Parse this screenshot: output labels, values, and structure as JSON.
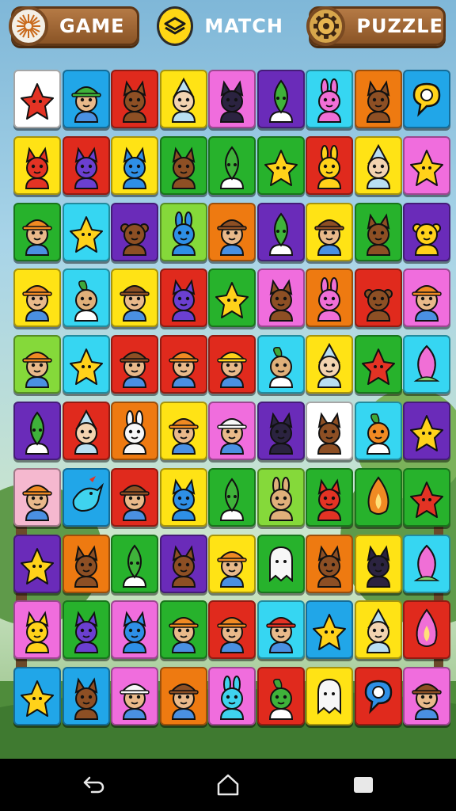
{
  "top_buttons": {
    "game_label": "GAME",
    "match_label": "MATCH",
    "puzzle_label": "PUZZLE"
  },
  "colors": {
    "white": "#ffffff",
    "blue": "#21a6e8",
    "red": "#e02a1d",
    "yellow": "#ffe315",
    "pink": "#f06ddd",
    "purple": "#6a2bb9",
    "cyan": "#36d6f2",
    "orange": "#ee7a11",
    "green": "#27b22c",
    "lime": "#85d93a",
    "lightpink": "#f5b8cf"
  },
  "board": {
    "rows": [
      [
        [
          "white",
          "red",
          "star-creature"
        ],
        [
          "blue",
          "green",
          "elf"
        ],
        [
          "red",
          "brown",
          "fox"
        ],
        [
          "yellow",
          "lightblue",
          "gnome"
        ],
        [
          "pink",
          "dark",
          "cat"
        ],
        [
          "purple",
          "green",
          "leaf-sprite"
        ],
        [
          "cyan",
          "pink",
          "bunny"
        ],
        [
          "orange",
          "brown",
          "fox"
        ],
        [
          "blue",
          "yellow",
          "speech-bubble"
        ]
      ],
      [
        [
          "yellow",
          "red",
          "cat"
        ],
        [
          "red",
          "purple",
          "cat"
        ],
        [
          "yellow",
          "blue",
          "cat"
        ],
        [
          "green",
          "brown",
          "fox"
        ],
        [
          "green",
          "green",
          "leaf-sprite"
        ],
        [
          "green",
          "yellow",
          "star-creature"
        ],
        [
          "red",
          "yellow",
          "bunny"
        ],
        [
          "yellow",
          "lightblue",
          "gnome"
        ],
        [
          "pink",
          "yellow",
          "star-creature"
        ]
      ],
      [
        [
          "green",
          "orange",
          "hat-kid"
        ],
        [
          "cyan",
          "yellow",
          "star-creature"
        ],
        [
          "purple",
          "brown",
          "monkey"
        ],
        [
          "lime",
          "blue",
          "bunny"
        ],
        [
          "orange",
          "brown",
          "hat-kid"
        ],
        [
          "purple",
          "green",
          "leaf-sprite"
        ],
        [
          "yellow",
          "brown",
          "hat-kid"
        ],
        [
          "green",
          "brown",
          "fox"
        ],
        [
          "purple",
          "yellow",
          "lion"
        ]
      ],
      [
        [
          "yellow",
          "orange",
          "hat-kid"
        ],
        [
          "cyan",
          "tan",
          "sprout"
        ],
        [
          "yellow",
          "brown",
          "hat-kid"
        ],
        [
          "red",
          "purple",
          "cat"
        ],
        [
          "green",
          "yellow",
          "star-creature"
        ],
        [
          "pink",
          "brown",
          "fox"
        ],
        [
          "orange",
          "pink",
          "bunny"
        ],
        [
          "red",
          "brown",
          "owl"
        ],
        [
          "pink",
          "orange",
          "hat-kid"
        ]
      ],
      [
        [
          "lime",
          "orange",
          "hat-kid"
        ],
        [
          "cyan",
          "yellow",
          "star-creature"
        ],
        [
          "red",
          "brown",
          "hat-kid"
        ],
        [
          "red",
          "orange",
          "hat-kid"
        ],
        [
          "red",
          "yellow",
          "hat-kid"
        ],
        [
          "cyan",
          "tan",
          "sprout"
        ],
        [
          "yellow",
          "lightblue",
          "gnome"
        ],
        [
          "green",
          "red",
          "star-creature"
        ],
        [
          "cyan",
          "pink",
          "flower-bud"
        ]
      ],
      [
        [
          "purple",
          "green",
          "leaf-sprite"
        ],
        [
          "red",
          "lightblue",
          "gnome"
        ],
        [
          "orange",
          "white",
          "bunny"
        ],
        [
          "yellow",
          "orange",
          "hat-kid"
        ],
        [
          "pink",
          "white",
          "hat-kid"
        ],
        [
          "purple",
          "dark",
          "cat"
        ],
        [
          "white",
          "brown",
          "fox"
        ],
        [
          "cyan",
          "orange",
          "sprout"
        ],
        [
          "purple",
          "yellow",
          "star-creature"
        ]
      ],
      [
        [
          "lightpink",
          "orange",
          "hat-kid"
        ],
        [
          "blue",
          "cyan",
          "bird"
        ],
        [
          "red",
          "brown",
          "hat-kid"
        ],
        [
          "yellow",
          "blue",
          "cat"
        ],
        [
          "green",
          "green",
          "leaf-sprite"
        ],
        [
          "lime",
          "tan",
          "bunny"
        ],
        [
          "green",
          "red",
          "fox"
        ],
        [
          "green",
          "orange",
          "flame"
        ],
        [
          "green",
          "red",
          "star-creature"
        ]
      ],
      [
        [
          "purple",
          "yellow",
          "star-creature"
        ],
        [
          "orange",
          "brown",
          "fox"
        ],
        [
          "green",
          "green",
          "leaf-sprite"
        ],
        [
          "purple",
          "brown",
          "fox"
        ],
        [
          "yellow",
          "orange",
          "hat-kid"
        ],
        [
          "green",
          "white",
          "ghost"
        ],
        [
          "orange",
          "brown",
          "fox"
        ],
        [
          "yellow",
          "dark",
          "cat"
        ],
        [
          "cyan",
          "pink",
          "flower-bud"
        ]
      ],
      [
        [
          "pink",
          "yellow",
          "cat"
        ],
        [
          "green",
          "purple",
          "cat"
        ],
        [
          "pink",
          "blue",
          "cat"
        ],
        [
          "green",
          "orange",
          "hat-kid"
        ],
        [
          "red",
          "orange",
          "hat-kid"
        ],
        [
          "cyan",
          "red",
          "hat-kid"
        ],
        [
          "blue",
          "yellow",
          "star-creature"
        ],
        [
          "yellow",
          "lightblue",
          "gnome"
        ],
        [
          "red",
          "pink",
          "flame"
        ]
      ],
      [
        [
          "blue",
          "yellow",
          "star-creature"
        ],
        [
          "blue",
          "brown",
          "fox"
        ],
        [
          "pink",
          "white",
          "hat-kid"
        ],
        [
          "orange",
          "brown",
          "hat-kid"
        ],
        [
          "pink",
          "cyan",
          "bunny"
        ],
        [
          "red",
          "green",
          "sprout"
        ],
        [
          "yellow",
          "white",
          "ghost"
        ],
        [
          "red",
          "blue",
          "speech-bubble"
        ],
        [
          "pink",
          "brown",
          "hat-kid"
        ]
      ]
    ]
  },
  "nav": {
    "back": "back-arrow-icon",
    "home": "home-icon",
    "recents": "recents-icon"
  }
}
